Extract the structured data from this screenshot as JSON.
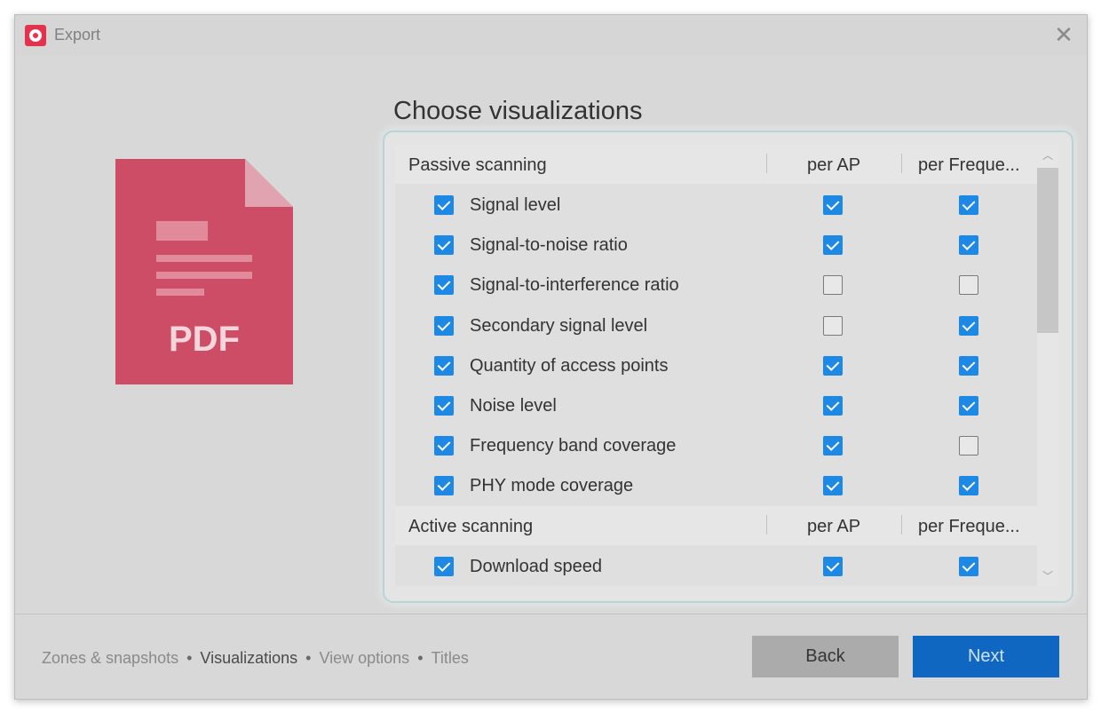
{
  "window": {
    "title": "Export",
    "close_symbol": "✕",
    "app_icon": "wifi-app-icon",
    "accent_color": "#1e88e5",
    "pdf_color": "#cd4d66"
  },
  "illustration": {
    "label": "PDF"
  },
  "heading": "Choose visualizations",
  "sections": [
    {
      "name": "Passive scanning",
      "col_ap": "per AP",
      "col_freq": "per Freque...",
      "rows": [
        {
          "label": "Signal level",
          "enabled": true,
          "per_ap": true,
          "per_freq": true
        },
        {
          "label": "Signal-to-noise ratio",
          "enabled": true,
          "per_ap": true,
          "per_freq": true
        },
        {
          "label": "Signal-to-interference ratio",
          "enabled": true,
          "per_ap": false,
          "per_freq": false
        },
        {
          "label": "Secondary signal level",
          "enabled": true,
          "per_ap": false,
          "per_freq": true
        },
        {
          "label": "Quantity of access points",
          "enabled": true,
          "per_ap": true,
          "per_freq": true
        },
        {
          "label": "Noise level",
          "enabled": true,
          "per_ap": true,
          "per_freq": true
        },
        {
          "label": "Frequency band coverage",
          "enabled": true,
          "per_ap": true,
          "per_freq": false
        },
        {
          "label": "PHY mode coverage",
          "enabled": true,
          "per_ap": true,
          "per_freq": true
        }
      ]
    },
    {
      "name": "Active scanning",
      "col_ap": "per AP",
      "col_freq": "per Freque...",
      "rows": [
        {
          "label": "Download speed",
          "enabled": true,
          "per_ap": true,
          "per_freq": true
        }
      ]
    }
  ],
  "scroll": {
    "up_symbol": "︿",
    "down_symbol": "﹀"
  },
  "breadcrumb": {
    "step1": "Zones & snapshots",
    "step2": "Visualizations",
    "step3": "View options",
    "step4": "Titles",
    "separator": "•"
  },
  "buttons": {
    "back": "Back",
    "next": "Next"
  }
}
